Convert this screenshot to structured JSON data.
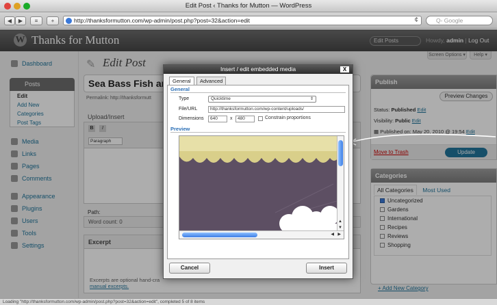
{
  "window": {
    "title": "Edit Post ‹ Thanks for Mutton — WordPress"
  },
  "toolbar": {
    "back": "◀",
    "forward": "▶",
    "bookmark": "≡",
    "add": "+",
    "url": "http://thanksformutton.com/wp-admin/post.php?post=32&action=edit",
    "reload": "¢",
    "search_placeholder": "Q- Google"
  },
  "wp_header": {
    "site_title": "Thanks for Mutton",
    "favorites": "Edit Posts",
    "howdy": "Howdy,",
    "user": "admin",
    "logout": "Log Out"
  },
  "sidebar": {
    "dashboard": "Dashboard",
    "posts": "Posts",
    "sub": [
      "Edit",
      "Add New",
      "Categories",
      "Post Tags"
    ],
    "media": "Media",
    "links": "Links",
    "pages": "Pages",
    "comments": "Comments",
    "appearance": "Appearance",
    "plugins": "Plugins",
    "users": "Users",
    "tools": "Tools",
    "settings": "Settings"
  },
  "main": {
    "page_title": "Edit Post",
    "post_title": "Sea Bass Fish an",
    "permalink": "Permalink: http://thanksformutt",
    "upload_insert": "Upload/Insert",
    "format": "Paragraph",
    "path": "Path:",
    "word_count": "Word count: 0",
    "excerpt_title": "Excerpt",
    "excerpt_note": "Excerpts are optional hand-cra",
    "excerpt_link": "manual excerpts."
  },
  "right": {
    "screen_options": "Screen Options ▾",
    "help": "Help ▾",
    "publish_title": "Publish",
    "preview_changes": "Preview Changes",
    "status_label": "Status:",
    "status_value": "Published",
    "status_edit": "Edit",
    "visibility_label": "Visibility:",
    "visibility_value": "Public",
    "visibility_edit": "Edit",
    "published_on": "Published on: May 20, 2010 @ 19:54",
    "published_edit": "Edit",
    "trash": "Move to Trash",
    "update": "Update",
    "categories_title": "Categories",
    "cat_tab_all": "All Categories",
    "cat_tab_used": "Most Used",
    "categories": [
      {
        "name": "Uncategorized",
        "checked": true
      },
      {
        "name": "Gardens",
        "checked": false
      },
      {
        "name": "International",
        "checked": false
      },
      {
        "name": "Recipes",
        "checked": false
      },
      {
        "name": "Reviews",
        "checked": false
      },
      {
        "name": "Shopping",
        "checked": false
      }
    ],
    "add_category": "+ Add New Category"
  },
  "modal": {
    "title": "Insert / edit embedded media",
    "close": "X",
    "tab_general": "General",
    "tab_advanced": "Advanced",
    "section_general": "General",
    "type_label": "Type",
    "type_value": "Quicktime",
    "url_label": "File/URL",
    "url_value": "http://thanksformutton.com/wp-content/uploads/",
    "dim_label": "Dimensions",
    "width": "640",
    "x": "x",
    "height": "480",
    "constrain": "Constrain proportions",
    "section_preview": "Preview",
    "cancel": "Cancel",
    "insert": "Insert"
  },
  "status_bar": "Loading \"http://thanksformutton.com/wp-admin/post.php?post=32&action=edit\", completed 5 of 8 items"
}
